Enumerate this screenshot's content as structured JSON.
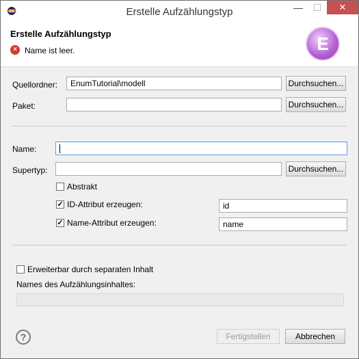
{
  "window": {
    "title": "Erstelle Aufzählungstyp",
    "minimize": "—",
    "maximize": "☐",
    "close": "✕"
  },
  "header": {
    "title": "Erstelle Aufzählungstyp",
    "error_message": "Name ist leer.",
    "error_icon": "error-icon",
    "wizard_icon_letter": "E"
  },
  "source_folder": {
    "label": "Quellordner:",
    "value": "EnumTutorial\\modell",
    "browse": "Durchsuchen..."
  },
  "package": {
    "label": "Paket:",
    "value": "",
    "browse": "Durchsuchen..."
  },
  "name": {
    "label": "Name:",
    "value": ""
  },
  "supertype": {
    "label": "Supertyp:",
    "value": "",
    "browse": "Durchsuchen..."
  },
  "abstract": {
    "label": "Abstrakt",
    "checked": false
  },
  "id_attribute": {
    "label": "ID-Attribut erzeugen:",
    "checked": true,
    "value": "id"
  },
  "name_attribute": {
    "label": "Name-Attribut erzeugen:",
    "checked": true,
    "value": "name"
  },
  "extensible": {
    "label": "Erweiterbar durch separaten Inhalt",
    "checked": false
  },
  "content_names": {
    "label": "Names des Aufzählungsinhaltes:",
    "value": ""
  },
  "footer": {
    "help_glyph": "?",
    "finish": "Fertigstellen",
    "cancel": "Abbrechen"
  },
  "colors": {
    "close_button": "#c75050",
    "error": "#d9372e",
    "focus_border": "#569de5",
    "wizard_icon": "#b15fd2"
  }
}
